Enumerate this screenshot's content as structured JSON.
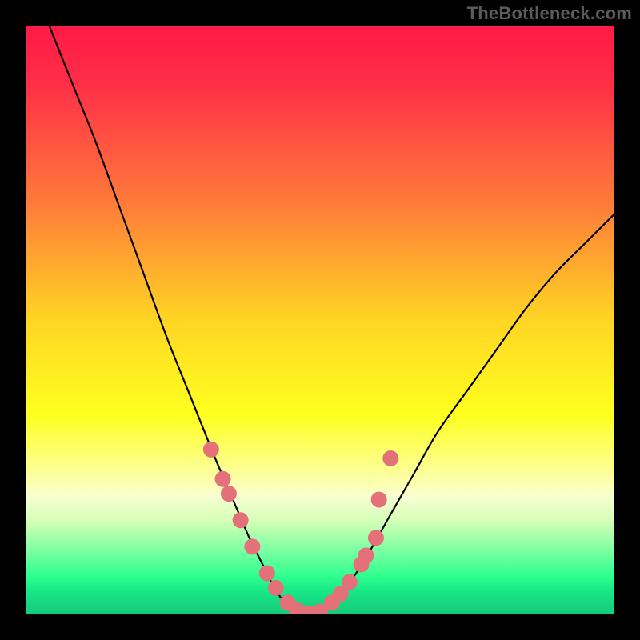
{
  "watermark": "TheBottleneck.com",
  "chart_data": {
    "type": "line",
    "title": "",
    "xlabel": "",
    "ylabel": "",
    "xlim": [
      0,
      100
    ],
    "ylim": [
      0,
      100
    ],
    "grid": false,
    "legend": false,
    "gradient_stops": [
      {
        "offset": 0.0,
        "color": "#ff1a46"
      },
      {
        "offset": 0.1,
        "color": "#ff2f47"
      },
      {
        "offset": 0.3,
        "color": "#ff7a3a"
      },
      {
        "offset": 0.5,
        "color": "#ffd524"
      },
      {
        "offset": 0.66,
        "color": "#ffff1e"
      },
      {
        "offset": 0.78,
        "color": "#fcffb3"
      },
      {
        "offset": 0.8,
        "color": "#f7ffd2"
      },
      {
        "offset": 0.84,
        "color": "#d6ffb8"
      },
      {
        "offset": 0.935,
        "color": "#2fff8f"
      },
      {
        "offset": 0.96,
        "color": "#18e887"
      },
      {
        "offset": 1.0,
        "color": "#15c97b"
      }
    ],
    "series": [
      {
        "name": "bottleneck-curve",
        "description": "V-shaped curve; estimated values read from plot (x in 0-100, y = 0 bottom, 100 top)",
        "x": [
          4,
          8,
          12,
          16,
          20,
          24,
          28,
          32,
          35,
          38,
          40,
          42,
          44,
          46,
          48,
          50,
          54,
          58,
          62,
          66,
          70,
          75,
          80,
          85,
          90,
          95,
          100
        ],
        "y": [
          100,
          90,
          80,
          69,
          58,
          47,
          37,
          27,
          20,
          13,
          9,
          5,
          2,
          0.5,
          0,
          0.5,
          4,
          10,
          17,
          24,
          31,
          38,
          45,
          52,
          58,
          63,
          68
        ]
      }
    ],
    "markers": {
      "name": "highlight-dots",
      "color": "#e4717a",
      "radius": 10,
      "points": [
        {
          "x": 31.5,
          "y": 28
        },
        {
          "x": 33.5,
          "y": 23
        },
        {
          "x": 34.5,
          "y": 20.5
        },
        {
          "x": 36.5,
          "y": 16
        },
        {
          "x": 38.5,
          "y": 11.5
        },
        {
          "x": 41.0,
          "y": 7
        },
        {
          "x": 42.5,
          "y": 4.5
        },
        {
          "x": 44.5,
          "y": 2
        },
        {
          "x": 46.0,
          "y": 0.8
        },
        {
          "x": 48.0,
          "y": 0.2
        },
        {
          "x": 50.0,
          "y": 0.5
        },
        {
          "x": 52.0,
          "y": 2
        },
        {
          "x": 53.5,
          "y": 3.5
        },
        {
          "x": 55.0,
          "y": 5.5
        },
        {
          "x": 57.0,
          "y": 8.5
        },
        {
          "x": 57.8,
          "y": 10
        },
        {
          "x": 59.5,
          "y": 13
        },
        {
          "x": 60.0,
          "y": 19.5
        },
        {
          "x": 62.0,
          "y": 26.5
        }
      ]
    }
  }
}
